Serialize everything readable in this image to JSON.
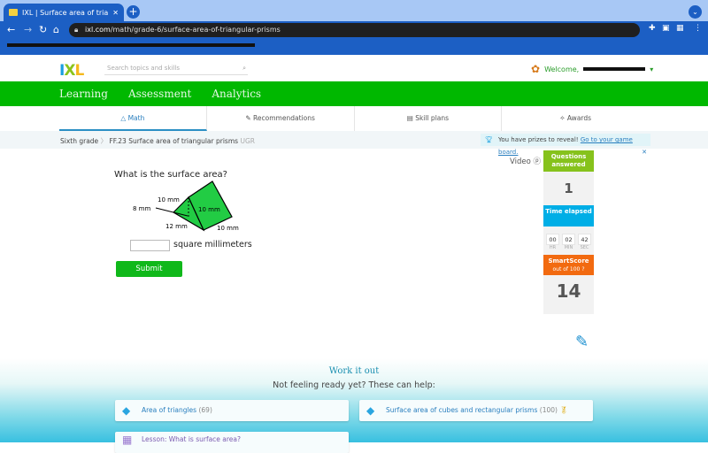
{
  "browser": {
    "tab_title": "IXL | Surface area of triangular",
    "url_host": "ixl.com",
    "url_path": "/math/grade-6/surface-area-of-triangular-prisms"
  },
  "header": {
    "logo": "IXL",
    "search_placeholder": "Search topics and skills",
    "welcome": "Welcome,"
  },
  "nav": {
    "items": [
      "Learning",
      "Assessment",
      "Analytics"
    ]
  },
  "subnav": {
    "items": [
      "Math",
      "Recommendations",
      "Skill plans",
      "Awards"
    ],
    "active": "Math"
  },
  "breadcrumb": {
    "grade": "Sixth grade",
    "skill": "FF.23 Surface area of triangular prisms",
    "code": "UGR"
  },
  "prize": {
    "text": "You have prizes to reveal!",
    "link": "Go to your game board."
  },
  "question": {
    "prompt": "What is the surface area?",
    "labels": [
      "10 mm",
      "8 mm",
      "12 mm",
      "10 mm",
      "10 mm"
    ],
    "answer_value": "",
    "unit": "square millimeters",
    "submit": "Submit"
  },
  "video": "Video",
  "sidebar": {
    "questions_label": "Questions answered",
    "questions": "1",
    "time_label": "Time elapsed",
    "hr": "00",
    "min": "02",
    "sec": "42",
    "hr_l": "HR",
    "min_l": "MIN",
    "sec_l": "SEC",
    "score_label": "SmartScore",
    "score_sub": "out of 100",
    "score": "14"
  },
  "help": {
    "title": "Work it out",
    "subtitle": "Not feeling ready yet? These can help:",
    "cards": [
      {
        "label": "Area of triangles",
        "count": "(69)"
      },
      {
        "label": "Surface area of cubes and rectangular prisms",
        "count": "(100)"
      },
      {
        "label": "Lesson: What is surface area?"
      }
    ]
  },
  "colors": {
    "green": "#00b800",
    "blue": "#00aee6",
    "orange": "#f26a10",
    "lime": "#86c21c"
  }
}
